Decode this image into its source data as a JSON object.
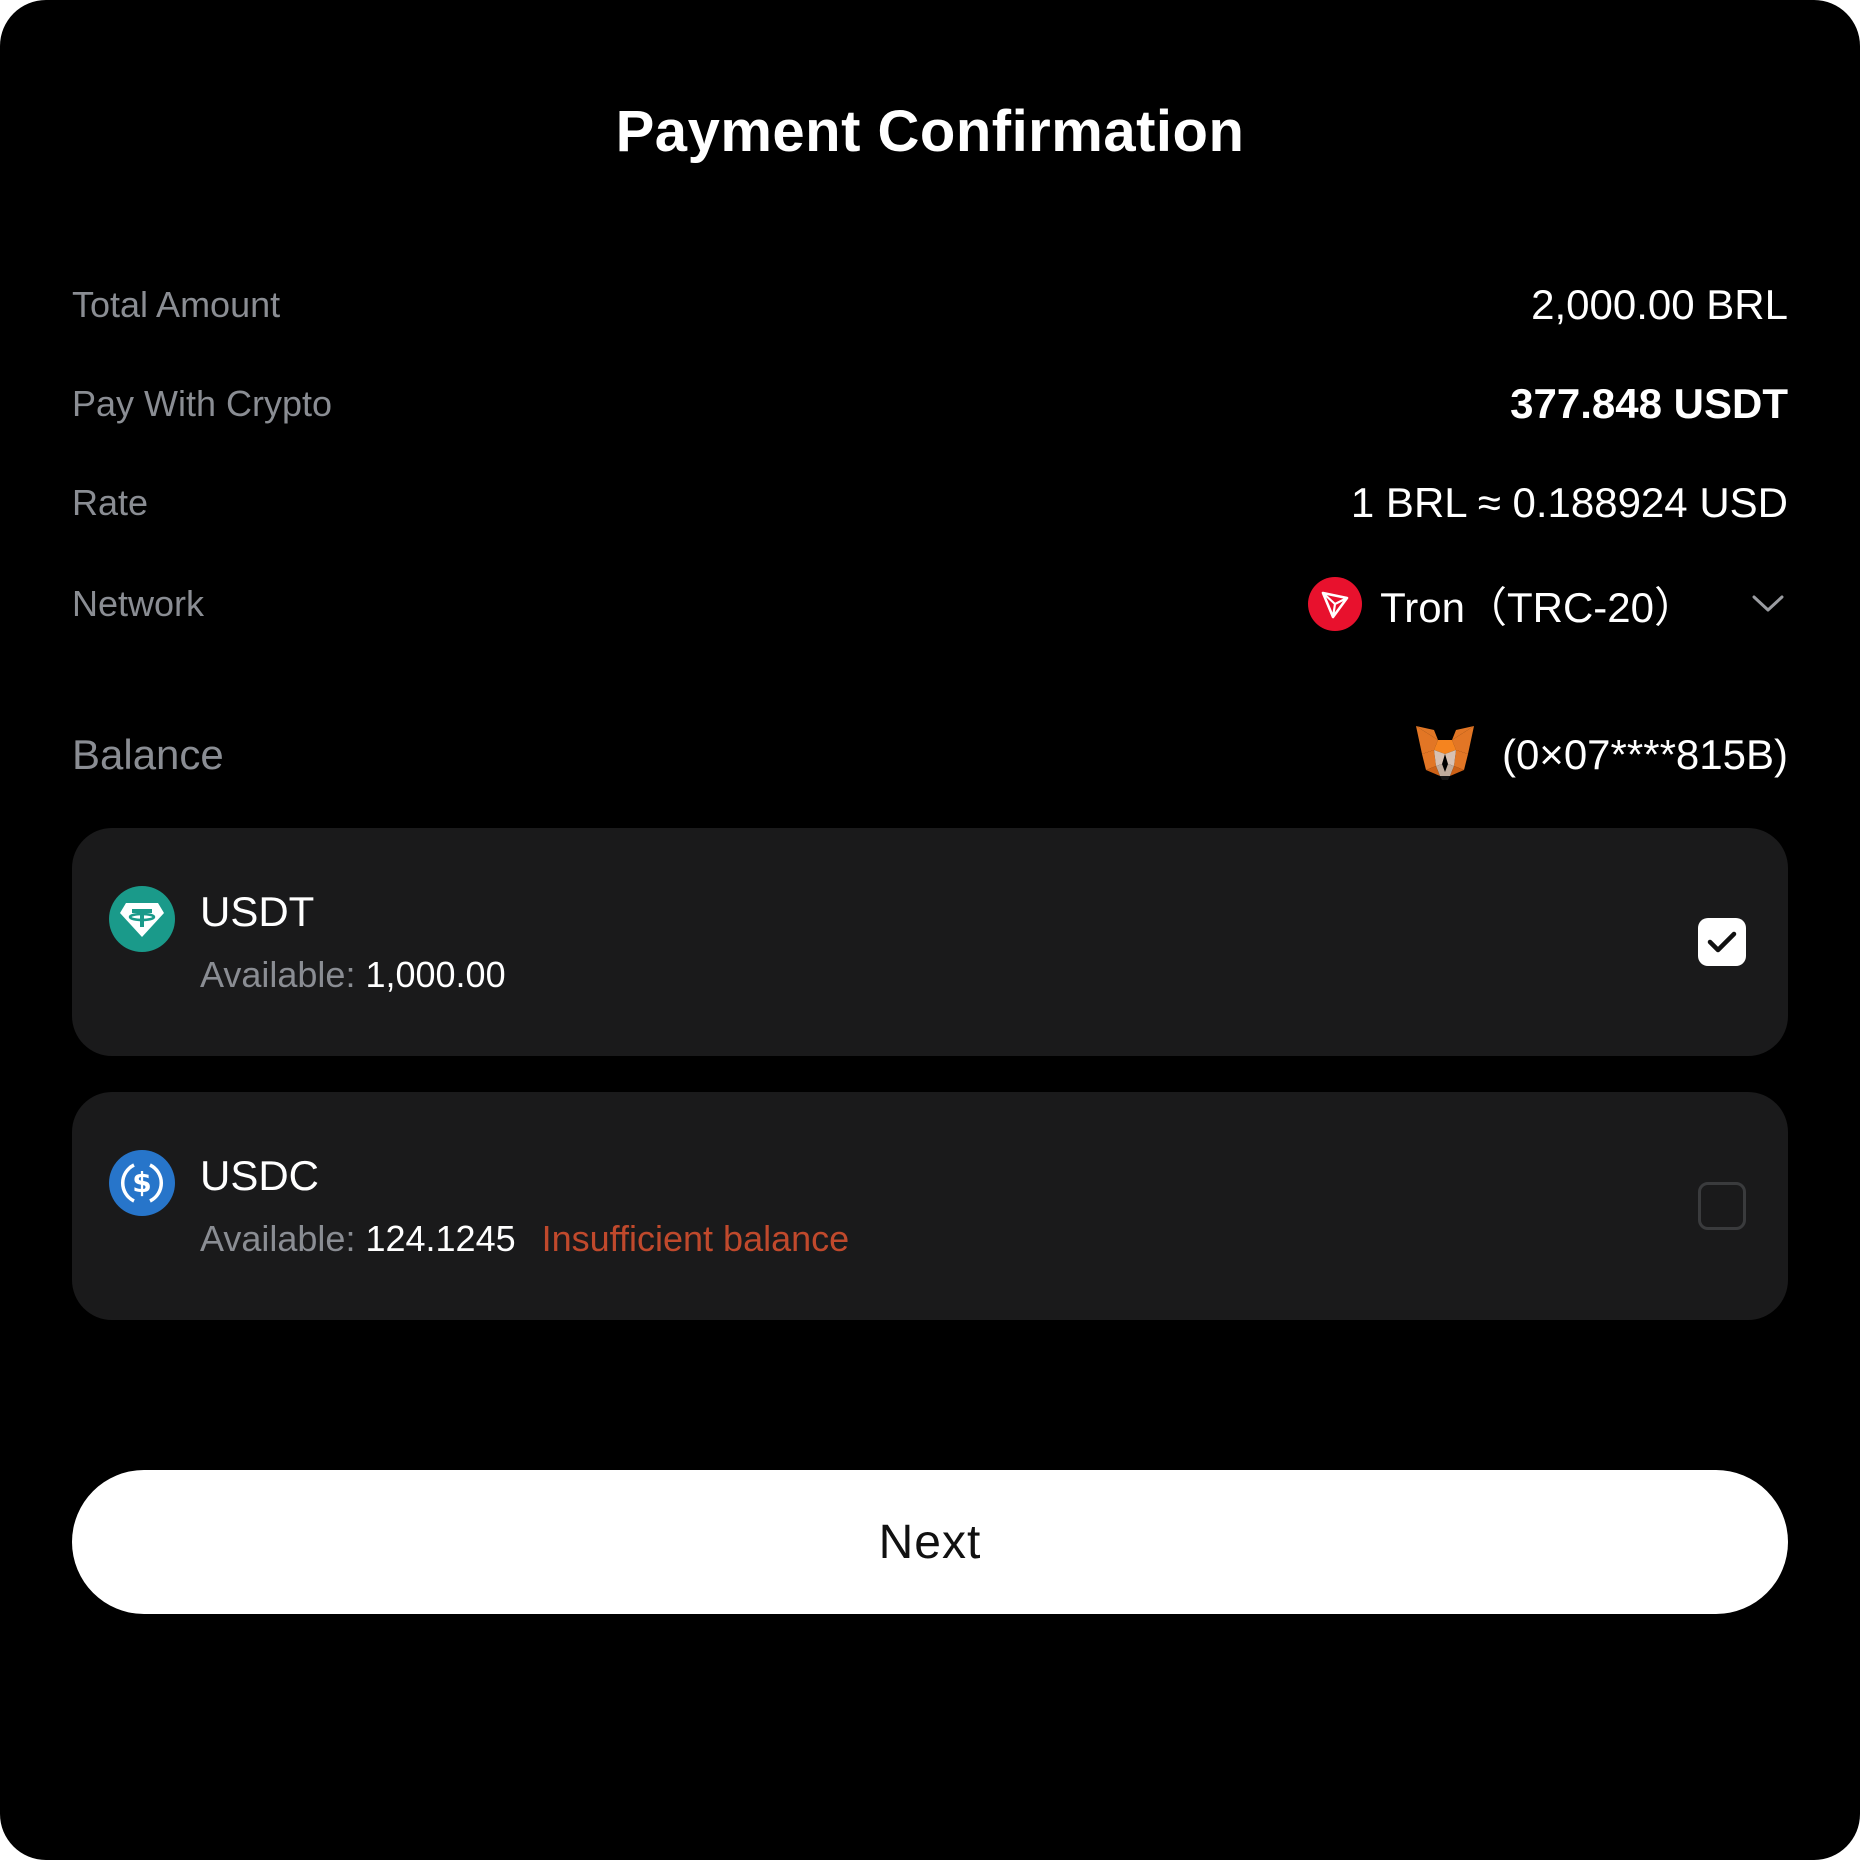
{
  "title": "Payment Confirmation",
  "details": {
    "total_amount": {
      "label": "Total Amount",
      "value": "2,000.00 BRL"
    },
    "pay_with_crypto": {
      "label": "Pay With Crypto",
      "value": "377.848 USDT"
    },
    "rate": {
      "label": "Rate",
      "value": "1 BRL ≈ 0.188924 USD"
    },
    "network": {
      "label": "Network",
      "value": "Tron（TRC-20）",
      "icon": "tron-icon"
    }
  },
  "balance": {
    "label": "Balance",
    "wallet_icon": "metamask-fox-icon",
    "wallet_address": "(0×07****815B)"
  },
  "tokens": [
    {
      "name": "USDT",
      "available_label": "Available:",
      "available_value": "1,000.00",
      "warning": "",
      "checked": true,
      "icon": "tether-icon",
      "icon_color": "#1a9a8a"
    },
    {
      "name": "USDC",
      "available_label": "Available:",
      "available_value": "124.1245",
      "warning": "Insufficient balance",
      "checked": false,
      "icon": "usdc-icon",
      "icon_color": "#2775ca"
    }
  ],
  "next_button": {
    "label": "Next"
  },
  "colors": {
    "background": "#000000",
    "card": "#1a1a1b",
    "muted_text": "#8a8d93",
    "warning": "#c0492c",
    "tron_red": "#e8112d"
  }
}
